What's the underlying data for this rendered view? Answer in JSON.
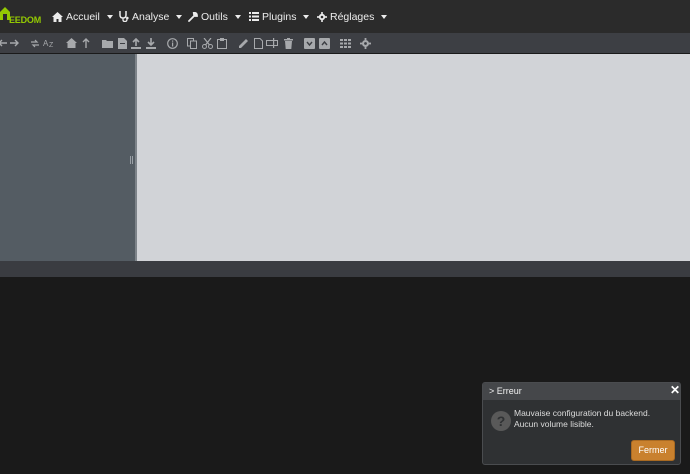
{
  "app": {
    "brand": "EEDOM"
  },
  "navbar": {
    "items": [
      {
        "label": "Accueil",
        "icon": "home-icon"
      },
      {
        "label": "Analyse",
        "icon": "stethoscope-icon"
      },
      {
        "label": "Outils",
        "icon": "wrench-icon"
      },
      {
        "label": "Plugins",
        "icon": "list-icon"
      },
      {
        "label": "Réglages",
        "icon": "gear-icon"
      }
    ]
  },
  "toolbar": {
    "icons": [
      "back-arrow-icon",
      "forward-arrow-icon",
      "refresh-icon",
      "sort-az-icon",
      "home-icon",
      "up-arrow-icon",
      "new-folder-icon",
      "new-file-icon",
      "upload-icon",
      "download-icon",
      "info-icon",
      "copy-icon",
      "cut-icon",
      "paste-icon",
      "edit-icon",
      "duplicate-icon",
      "rename-icon",
      "delete-icon",
      "archive-icon",
      "extract-icon",
      "grid-view-icon",
      "settings-icon"
    ]
  },
  "dialog": {
    "title": "> Erreur",
    "close": "✕",
    "icon": "question-icon",
    "message_line1": "Mauvaise configuration du backend.",
    "message_line2": "Aucun volume lisible.",
    "button_label": "Fermer"
  },
  "colors": {
    "brand": "#94ca02",
    "button": "#c9812e",
    "navbar": "#2b2b2b",
    "toolbar": "#3d3f44",
    "left_pane": "#545c63",
    "main_pane": "#d1d3d7"
  }
}
